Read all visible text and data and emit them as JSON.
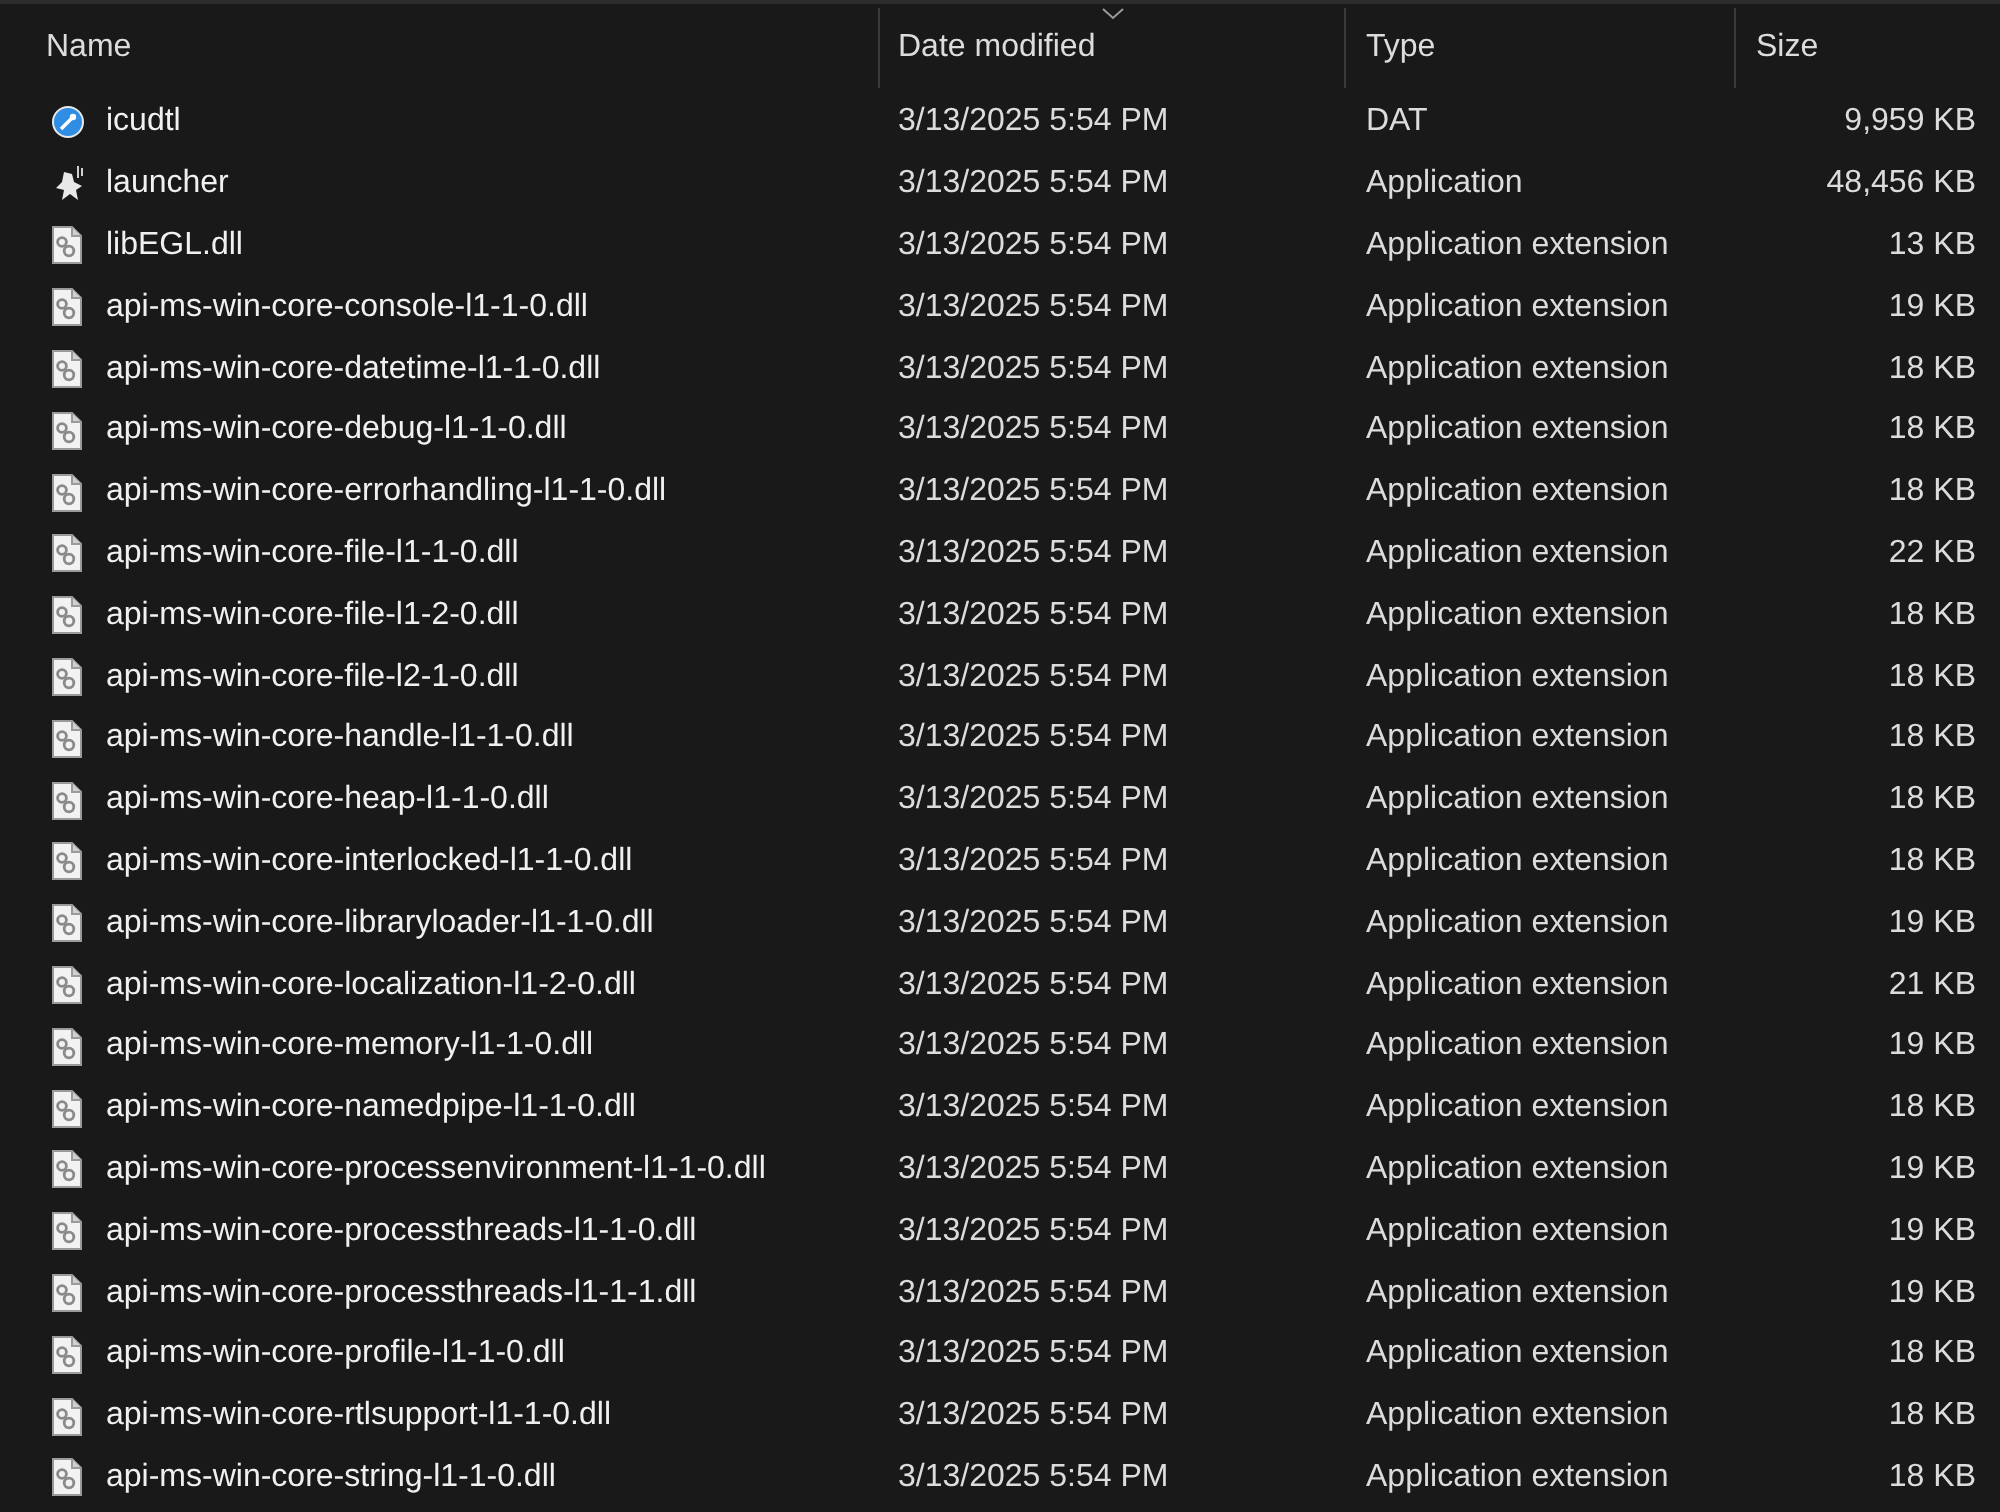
{
  "columns": [
    {
      "label": "Name",
      "sorted": false
    },
    {
      "label": "Date modified",
      "sorted": true
    },
    {
      "label": "Type",
      "sorted": false
    },
    {
      "label": "Size",
      "sorted": false
    }
  ],
  "rows": [
    {
      "kind": "data",
      "name": "icudtl",
      "date": "3/13/2025 5:54 PM",
      "type": "DAT",
      "size": "9,959 KB"
    },
    {
      "kind": "app",
      "name": "launcher",
      "date": "3/13/2025 5:54 PM",
      "type": "Application",
      "size": "48,456 KB"
    },
    {
      "kind": "dll",
      "name": "libEGL.dll",
      "date": "3/13/2025 5:54 PM",
      "type": "Application extension",
      "size": "13 KB"
    },
    {
      "kind": "dll",
      "name": "api-ms-win-core-console-l1-1-0.dll",
      "date": "3/13/2025 5:54 PM",
      "type": "Application extension",
      "size": "19 KB"
    },
    {
      "kind": "dll",
      "name": "api-ms-win-core-datetime-l1-1-0.dll",
      "date": "3/13/2025 5:54 PM",
      "type": "Application extension",
      "size": "18 KB"
    },
    {
      "kind": "dll",
      "name": "api-ms-win-core-debug-l1-1-0.dll",
      "date": "3/13/2025 5:54 PM",
      "type": "Application extension",
      "size": "18 KB"
    },
    {
      "kind": "dll",
      "name": "api-ms-win-core-errorhandling-l1-1-0.dll",
      "date": "3/13/2025 5:54 PM",
      "type": "Application extension",
      "size": "18 KB"
    },
    {
      "kind": "dll",
      "name": "api-ms-win-core-file-l1-1-0.dll",
      "date": "3/13/2025 5:54 PM",
      "type": "Application extension",
      "size": "22 KB"
    },
    {
      "kind": "dll",
      "name": "api-ms-win-core-file-l1-2-0.dll",
      "date": "3/13/2025 5:54 PM",
      "type": "Application extension",
      "size": "18 KB"
    },
    {
      "kind": "dll",
      "name": "api-ms-win-core-file-l2-1-0.dll",
      "date": "3/13/2025 5:54 PM",
      "type": "Application extension",
      "size": "18 KB"
    },
    {
      "kind": "dll",
      "name": "api-ms-win-core-handle-l1-1-0.dll",
      "date": "3/13/2025 5:54 PM",
      "type": "Application extension",
      "size": "18 KB"
    },
    {
      "kind": "dll",
      "name": "api-ms-win-core-heap-l1-1-0.dll",
      "date": "3/13/2025 5:54 PM",
      "type": "Application extension",
      "size": "18 KB"
    },
    {
      "kind": "dll",
      "name": "api-ms-win-core-interlocked-l1-1-0.dll",
      "date": "3/13/2025 5:54 PM",
      "type": "Application extension",
      "size": "18 KB"
    },
    {
      "kind": "dll",
      "name": "api-ms-win-core-libraryloader-l1-1-0.dll",
      "date": "3/13/2025 5:54 PM",
      "type": "Application extension",
      "size": "19 KB"
    },
    {
      "kind": "dll",
      "name": "api-ms-win-core-localization-l1-2-0.dll",
      "date": "3/13/2025 5:54 PM",
      "type": "Application extension",
      "size": "21 KB"
    },
    {
      "kind": "dll",
      "name": "api-ms-win-core-memory-l1-1-0.dll",
      "date": "3/13/2025 5:54 PM",
      "type": "Application extension",
      "size": "19 KB"
    },
    {
      "kind": "dll",
      "name": "api-ms-win-core-namedpipe-l1-1-0.dll",
      "date": "3/13/2025 5:54 PM",
      "type": "Application extension",
      "size": "18 KB"
    },
    {
      "kind": "dll",
      "name": "api-ms-win-core-processenvironment-l1-1-0.dll",
      "date": "3/13/2025 5:54 PM",
      "type": "Application extension",
      "size": "19 KB"
    },
    {
      "kind": "dll",
      "name": "api-ms-win-core-processthreads-l1-1-0.dll",
      "date": "3/13/2025 5:54 PM",
      "type": "Application extension",
      "size": "19 KB"
    },
    {
      "kind": "dll",
      "name": "api-ms-win-core-processthreads-l1-1-1.dll",
      "date": "3/13/2025 5:54 PM",
      "type": "Application extension",
      "size": "19 KB"
    },
    {
      "kind": "dll",
      "name": "api-ms-win-core-profile-l1-1-0.dll",
      "date": "3/13/2025 5:54 PM",
      "type": "Application extension",
      "size": "18 KB"
    },
    {
      "kind": "dll",
      "name": "api-ms-win-core-rtlsupport-l1-1-0.dll",
      "date": "3/13/2025 5:54 PM",
      "type": "Application extension",
      "size": "18 KB"
    },
    {
      "kind": "dll",
      "name": "api-ms-win-core-string-l1-1-0.dll",
      "date": "3/13/2025 5:54 PM",
      "type": "Application extension",
      "size": "18 KB"
    }
  ]
}
